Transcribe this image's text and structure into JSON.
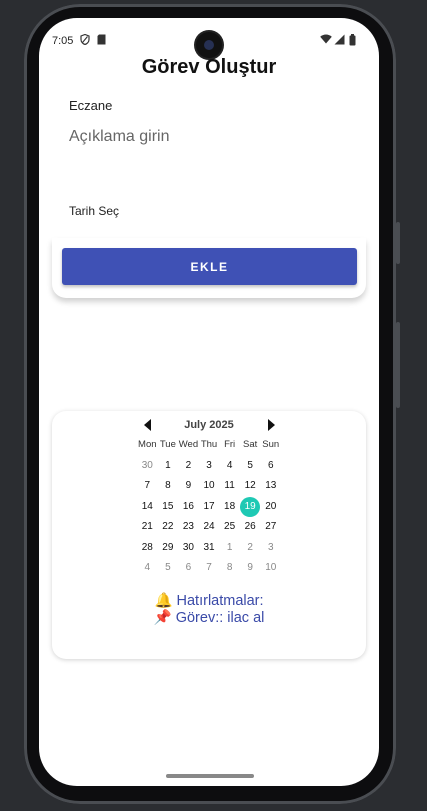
{
  "status_bar": {
    "time": "7:05",
    "left_icons": [
      "shield-icon",
      "sim-card-icon"
    ],
    "right_icons": [
      "wifi-icon",
      "signal-icon",
      "battery-icon"
    ]
  },
  "page": {
    "title": "Görev Oluştur",
    "task_name_label": "Eczane",
    "description_placeholder": "Açıklama girin",
    "date_label": "Tarih Seç",
    "add_button": "EKLE"
  },
  "calendar": {
    "month_label": "July 2025",
    "weekdays": [
      "Mon",
      "Tue",
      "Wed",
      "Thu",
      "Fri",
      "Sat",
      "Sun"
    ],
    "selected_day": 19,
    "weeks": [
      [
        {
          "d": "30",
          "m": false
        },
        {
          "d": "1",
          "m": true
        },
        {
          "d": "2",
          "m": true
        },
        {
          "d": "3",
          "m": true
        },
        {
          "d": "4",
          "m": true
        },
        {
          "d": "5",
          "m": true
        },
        {
          "d": "6",
          "m": true
        }
      ],
      [
        {
          "d": "7",
          "m": true
        },
        {
          "d": "8",
          "m": true
        },
        {
          "d": "9",
          "m": true
        },
        {
          "d": "10",
          "m": true
        },
        {
          "d": "11",
          "m": true
        },
        {
          "d": "12",
          "m": true
        },
        {
          "d": "13",
          "m": true
        }
      ],
      [
        {
          "d": "14",
          "m": true
        },
        {
          "d": "15",
          "m": true
        },
        {
          "d": "16",
          "m": true
        },
        {
          "d": "17",
          "m": true
        },
        {
          "d": "18",
          "m": true
        },
        {
          "d": "19",
          "m": true
        },
        {
          "d": "20",
          "m": true
        }
      ],
      [
        {
          "d": "21",
          "m": true
        },
        {
          "d": "22",
          "m": true
        },
        {
          "d": "23",
          "m": true
        },
        {
          "d": "24",
          "m": true
        },
        {
          "d": "25",
          "m": true
        },
        {
          "d": "26",
          "m": true
        },
        {
          "d": "27",
          "m": true
        }
      ],
      [
        {
          "d": "28",
          "m": true
        },
        {
          "d": "29",
          "m": true
        },
        {
          "d": "30",
          "m": true
        },
        {
          "d": "31",
          "m": true
        },
        {
          "d": "1",
          "m": false
        },
        {
          "d": "2",
          "m": false
        },
        {
          "d": "3",
          "m": false
        }
      ],
      [
        {
          "d": "4",
          "m": false
        },
        {
          "d": "5",
          "m": false
        },
        {
          "d": "6",
          "m": false
        },
        {
          "d": "7",
          "m": false
        },
        {
          "d": "8",
          "m": false
        },
        {
          "d": "9",
          "m": false
        },
        {
          "d": "10",
          "m": false
        }
      ]
    ],
    "selected_color": "#1ec9b4"
  },
  "reminders": {
    "heading": "🔔 Hatırlatmalar:",
    "items": [
      "📌 Görev:: ilac al"
    ]
  },
  "colors": {
    "primary": "#3f51b5",
    "reminder_text": "#3a4aa8"
  }
}
